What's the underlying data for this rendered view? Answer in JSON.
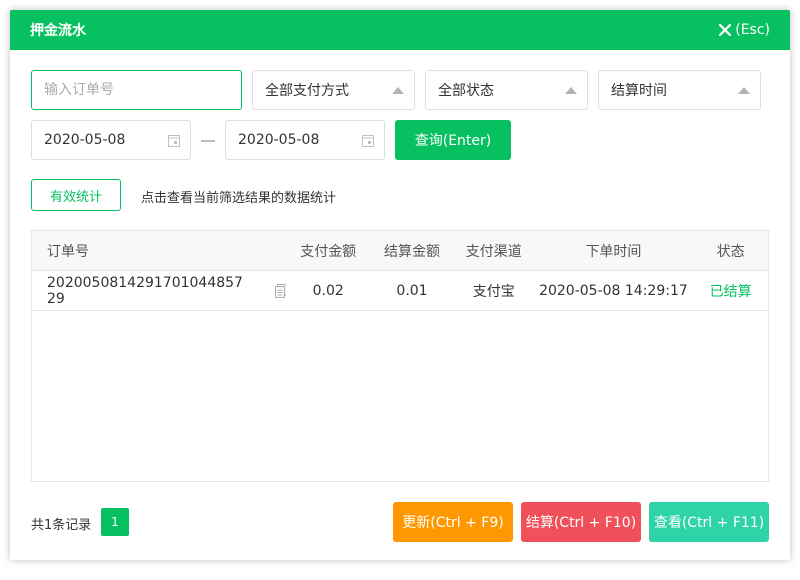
{
  "dialog": {
    "title": "押金流水",
    "close_label": "(Esc)"
  },
  "filters": {
    "order_placeholder": "输入订单号",
    "order_value": "",
    "pay_method": "全部支付方式",
    "status": "全部状态",
    "time_type": "结算时间",
    "date_start": "2020-05-08",
    "date_end": "2020-05-08",
    "query_label": "查询(Enter)"
  },
  "stats": {
    "button_label": "有效统计",
    "hint": "点击查看当前筛选结果的数据统计"
  },
  "table": {
    "headers": [
      "订单号",
      "支付金额",
      "结算金额",
      "支付渠道",
      "下单时间",
      "状态"
    ],
    "rows": [
      {
        "order_no": "2020050814291701044857 29",
        "pay_amount": "0.02",
        "settle_amount": "0.01",
        "channel": "支付宝",
        "order_time": "2020-05-08 14:29:17",
        "status": "已结算"
      }
    ]
  },
  "footer": {
    "total": "共1条记录",
    "page": "1",
    "update_label": "更新(Ctrl + F9)",
    "settle_label": "结算(Ctrl + F10)",
    "view_label": "查看(Ctrl + F11)"
  },
  "colors": {
    "primary": "#07c160",
    "update": "#ff9800",
    "settle": "#f0505a",
    "view": "#2ed3a7"
  },
  "icons": [
    "close-icon",
    "calendar-icon",
    "copy-icon",
    "dropdown-triangle-icon"
  ]
}
